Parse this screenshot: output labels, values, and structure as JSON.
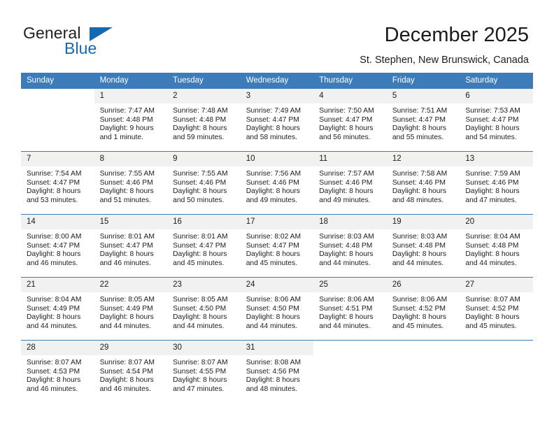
{
  "brand": {
    "word1": "General",
    "word2": "Blue",
    "triangle_color": "#1569b0"
  },
  "header": {
    "title": "December 2025",
    "subtitle": "St. Stephen, New Brunswick, Canada",
    "accent_color": "#3d7cbb"
  },
  "calendar": {
    "weekday_headers": [
      "Sunday",
      "Monday",
      "Tuesday",
      "Wednesday",
      "Thursday",
      "Friday",
      "Saturday"
    ],
    "labels": {
      "sunrise": "Sunrise:",
      "sunset": "Sunset:",
      "daylight": "Daylight:"
    },
    "weeks": [
      [
        {
          "day": "",
          "sunrise": "",
          "sunset": "",
          "daylight": ""
        },
        {
          "day": "1",
          "sunrise": "Sunrise: 7:47 AM",
          "sunset": "Sunset: 4:48 PM",
          "daylight": "Daylight: 9 hours and 1 minute."
        },
        {
          "day": "2",
          "sunrise": "Sunrise: 7:48 AM",
          "sunset": "Sunset: 4:48 PM",
          "daylight": "Daylight: 8 hours and 59 minutes."
        },
        {
          "day": "3",
          "sunrise": "Sunrise: 7:49 AM",
          "sunset": "Sunset: 4:47 PM",
          "daylight": "Daylight: 8 hours and 58 minutes."
        },
        {
          "day": "4",
          "sunrise": "Sunrise: 7:50 AM",
          "sunset": "Sunset: 4:47 PM",
          "daylight": "Daylight: 8 hours and 56 minutes."
        },
        {
          "day": "5",
          "sunrise": "Sunrise: 7:51 AM",
          "sunset": "Sunset: 4:47 PM",
          "daylight": "Daylight: 8 hours and 55 minutes."
        },
        {
          "day": "6",
          "sunrise": "Sunrise: 7:53 AM",
          "sunset": "Sunset: 4:47 PM",
          "daylight": "Daylight: 8 hours and 54 minutes."
        }
      ],
      [
        {
          "day": "7",
          "sunrise": "Sunrise: 7:54 AM",
          "sunset": "Sunset: 4:47 PM",
          "daylight": "Daylight: 8 hours and 53 minutes."
        },
        {
          "day": "8",
          "sunrise": "Sunrise: 7:55 AM",
          "sunset": "Sunset: 4:46 PM",
          "daylight": "Daylight: 8 hours and 51 minutes."
        },
        {
          "day": "9",
          "sunrise": "Sunrise: 7:55 AM",
          "sunset": "Sunset: 4:46 PM",
          "daylight": "Daylight: 8 hours and 50 minutes."
        },
        {
          "day": "10",
          "sunrise": "Sunrise: 7:56 AM",
          "sunset": "Sunset: 4:46 PM",
          "daylight": "Daylight: 8 hours and 49 minutes."
        },
        {
          "day": "11",
          "sunrise": "Sunrise: 7:57 AM",
          "sunset": "Sunset: 4:46 PM",
          "daylight": "Daylight: 8 hours and 49 minutes."
        },
        {
          "day": "12",
          "sunrise": "Sunrise: 7:58 AM",
          "sunset": "Sunset: 4:46 PM",
          "daylight": "Daylight: 8 hours and 48 minutes."
        },
        {
          "day": "13",
          "sunrise": "Sunrise: 7:59 AM",
          "sunset": "Sunset: 4:46 PM",
          "daylight": "Daylight: 8 hours and 47 minutes."
        }
      ],
      [
        {
          "day": "14",
          "sunrise": "Sunrise: 8:00 AM",
          "sunset": "Sunset: 4:47 PM",
          "daylight": "Daylight: 8 hours and 46 minutes."
        },
        {
          "day": "15",
          "sunrise": "Sunrise: 8:01 AM",
          "sunset": "Sunset: 4:47 PM",
          "daylight": "Daylight: 8 hours and 46 minutes."
        },
        {
          "day": "16",
          "sunrise": "Sunrise: 8:01 AM",
          "sunset": "Sunset: 4:47 PM",
          "daylight": "Daylight: 8 hours and 45 minutes."
        },
        {
          "day": "17",
          "sunrise": "Sunrise: 8:02 AM",
          "sunset": "Sunset: 4:47 PM",
          "daylight": "Daylight: 8 hours and 45 minutes."
        },
        {
          "day": "18",
          "sunrise": "Sunrise: 8:03 AM",
          "sunset": "Sunset: 4:48 PM",
          "daylight": "Daylight: 8 hours and 44 minutes."
        },
        {
          "day": "19",
          "sunrise": "Sunrise: 8:03 AM",
          "sunset": "Sunset: 4:48 PM",
          "daylight": "Daylight: 8 hours and 44 minutes."
        },
        {
          "day": "20",
          "sunrise": "Sunrise: 8:04 AM",
          "sunset": "Sunset: 4:48 PM",
          "daylight": "Daylight: 8 hours and 44 minutes."
        }
      ],
      [
        {
          "day": "21",
          "sunrise": "Sunrise: 8:04 AM",
          "sunset": "Sunset: 4:49 PM",
          "daylight": "Daylight: 8 hours and 44 minutes."
        },
        {
          "day": "22",
          "sunrise": "Sunrise: 8:05 AM",
          "sunset": "Sunset: 4:49 PM",
          "daylight": "Daylight: 8 hours and 44 minutes."
        },
        {
          "day": "23",
          "sunrise": "Sunrise: 8:05 AM",
          "sunset": "Sunset: 4:50 PM",
          "daylight": "Daylight: 8 hours and 44 minutes."
        },
        {
          "day": "24",
          "sunrise": "Sunrise: 8:06 AM",
          "sunset": "Sunset: 4:50 PM",
          "daylight": "Daylight: 8 hours and 44 minutes."
        },
        {
          "day": "25",
          "sunrise": "Sunrise: 8:06 AM",
          "sunset": "Sunset: 4:51 PM",
          "daylight": "Daylight: 8 hours and 44 minutes."
        },
        {
          "day": "26",
          "sunrise": "Sunrise: 8:06 AM",
          "sunset": "Sunset: 4:52 PM",
          "daylight": "Daylight: 8 hours and 45 minutes."
        },
        {
          "day": "27",
          "sunrise": "Sunrise: 8:07 AM",
          "sunset": "Sunset: 4:52 PM",
          "daylight": "Daylight: 8 hours and 45 minutes."
        }
      ],
      [
        {
          "day": "28",
          "sunrise": "Sunrise: 8:07 AM",
          "sunset": "Sunset: 4:53 PM",
          "daylight": "Daylight: 8 hours and 46 minutes."
        },
        {
          "day": "29",
          "sunrise": "Sunrise: 8:07 AM",
          "sunset": "Sunset: 4:54 PM",
          "daylight": "Daylight: 8 hours and 46 minutes."
        },
        {
          "day": "30",
          "sunrise": "Sunrise: 8:07 AM",
          "sunset": "Sunset: 4:55 PM",
          "daylight": "Daylight: 8 hours and 47 minutes."
        },
        {
          "day": "31",
          "sunrise": "Sunrise: 8:08 AM",
          "sunset": "Sunset: 4:56 PM",
          "daylight": "Daylight: 8 hours and 48 minutes."
        },
        {
          "day": "",
          "sunrise": "",
          "sunset": "",
          "daylight": ""
        },
        {
          "day": "",
          "sunrise": "",
          "sunset": "",
          "daylight": ""
        },
        {
          "day": "",
          "sunrise": "",
          "sunset": "",
          "daylight": ""
        }
      ]
    ]
  }
}
